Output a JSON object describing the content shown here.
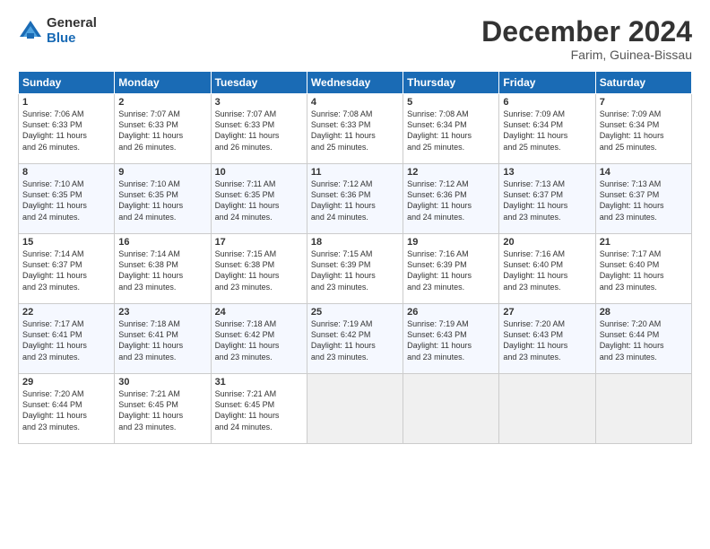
{
  "header": {
    "logo_general": "General",
    "logo_blue": "Blue",
    "month_title": "December 2024",
    "location": "Farim, Guinea-Bissau"
  },
  "weekdays": [
    "Sunday",
    "Monday",
    "Tuesday",
    "Wednesday",
    "Thursday",
    "Friday",
    "Saturday"
  ],
  "weeks": [
    [
      {
        "day": "1",
        "info": "Sunrise: 7:06 AM\nSunset: 6:33 PM\nDaylight: 11 hours\nand 26 minutes."
      },
      {
        "day": "2",
        "info": "Sunrise: 7:07 AM\nSunset: 6:33 PM\nDaylight: 11 hours\nand 26 minutes."
      },
      {
        "day": "3",
        "info": "Sunrise: 7:07 AM\nSunset: 6:33 PM\nDaylight: 11 hours\nand 26 minutes."
      },
      {
        "day": "4",
        "info": "Sunrise: 7:08 AM\nSunset: 6:33 PM\nDaylight: 11 hours\nand 25 minutes."
      },
      {
        "day": "5",
        "info": "Sunrise: 7:08 AM\nSunset: 6:34 PM\nDaylight: 11 hours\nand 25 minutes."
      },
      {
        "day": "6",
        "info": "Sunrise: 7:09 AM\nSunset: 6:34 PM\nDaylight: 11 hours\nand 25 minutes."
      },
      {
        "day": "7",
        "info": "Sunrise: 7:09 AM\nSunset: 6:34 PM\nDaylight: 11 hours\nand 25 minutes."
      }
    ],
    [
      {
        "day": "8",
        "info": "Sunrise: 7:10 AM\nSunset: 6:35 PM\nDaylight: 11 hours\nand 24 minutes."
      },
      {
        "day": "9",
        "info": "Sunrise: 7:10 AM\nSunset: 6:35 PM\nDaylight: 11 hours\nand 24 minutes."
      },
      {
        "day": "10",
        "info": "Sunrise: 7:11 AM\nSunset: 6:35 PM\nDaylight: 11 hours\nand 24 minutes."
      },
      {
        "day": "11",
        "info": "Sunrise: 7:12 AM\nSunset: 6:36 PM\nDaylight: 11 hours\nand 24 minutes."
      },
      {
        "day": "12",
        "info": "Sunrise: 7:12 AM\nSunset: 6:36 PM\nDaylight: 11 hours\nand 24 minutes."
      },
      {
        "day": "13",
        "info": "Sunrise: 7:13 AM\nSunset: 6:37 PM\nDaylight: 11 hours\nand 23 minutes."
      },
      {
        "day": "14",
        "info": "Sunrise: 7:13 AM\nSunset: 6:37 PM\nDaylight: 11 hours\nand 23 minutes."
      }
    ],
    [
      {
        "day": "15",
        "info": "Sunrise: 7:14 AM\nSunset: 6:37 PM\nDaylight: 11 hours\nand 23 minutes."
      },
      {
        "day": "16",
        "info": "Sunrise: 7:14 AM\nSunset: 6:38 PM\nDaylight: 11 hours\nand 23 minutes."
      },
      {
        "day": "17",
        "info": "Sunrise: 7:15 AM\nSunset: 6:38 PM\nDaylight: 11 hours\nand 23 minutes."
      },
      {
        "day": "18",
        "info": "Sunrise: 7:15 AM\nSunset: 6:39 PM\nDaylight: 11 hours\nand 23 minutes."
      },
      {
        "day": "19",
        "info": "Sunrise: 7:16 AM\nSunset: 6:39 PM\nDaylight: 11 hours\nand 23 minutes."
      },
      {
        "day": "20",
        "info": "Sunrise: 7:16 AM\nSunset: 6:40 PM\nDaylight: 11 hours\nand 23 minutes."
      },
      {
        "day": "21",
        "info": "Sunrise: 7:17 AM\nSunset: 6:40 PM\nDaylight: 11 hours\nand 23 minutes."
      }
    ],
    [
      {
        "day": "22",
        "info": "Sunrise: 7:17 AM\nSunset: 6:41 PM\nDaylight: 11 hours\nand 23 minutes."
      },
      {
        "day": "23",
        "info": "Sunrise: 7:18 AM\nSunset: 6:41 PM\nDaylight: 11 hours\nand 23 minutes."
      },
      {
        "day": "24",
        "info": "Sunrise: 7:18 AM\nSunset: 6:42 PM\nDaylight: 11 hours\nand 23 minutes."
      },
      {
        "day": "25",
        "info": "Sunrise: 7:19 AM\nSunset: 6:42 PM\nDaylight: 11 hours\nand 23 minutes."
      },
      {
        "day": "26",
        "info": "Sunrise: 7:19 AM\nSunset: 6:43 PM\nDaylight: 11 hours\nand 23 minutes."
      },
      {
        "day": "27",
        "info": "Sunrise: 7:20 AM\nSunset: 6:43 PM\nDaylight: 11 hours\nand 23 minutes."
      },
      {
        "day": "28",
        "info": "Sunrise: 7:20 AM\nSunset: 6:44 PM\nDaylight: 11 hours\nand 23 minutes."
      }
    ],
    [
      {
        "day": "29",
        "info": "Sunrise: 7:20 AM\nSunset: 6:44 PM\nDaylight: 11 hours\nand 23 minutes."
      },
      {
        "day": "30",
        "info": "Sunrise: 7:21 AM\nSunset: 6:45 PM\nDaylight: 11 hours\nand 23 minutes."
      },
      {
        "day": "31",
        "info": "Sunrise: 7:21 AM\nSunset: 6:45 PM\nDaylight: 11 hours\nand 24 minutes."
      },
      {
        "day": "",
        "info": ""
      },
      {
        "day": "",
        "info": ""
      },
      {
        "day": "",
        "info": ""
      },
      {
        "day": "",
        "info": ""
      }
    ]
  ]
}
